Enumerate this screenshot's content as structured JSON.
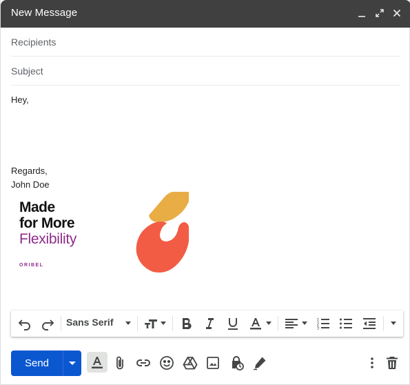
{
  "window": {
    "title": "New Message"
  },
  "compose": {
    "recipients_placeholder": "Recipients",
    "subject_placeholder": "Subject",
    "body": {
      "greeting": "Hey,",
      "regards": "Regards,",
      "name": "John Doe"
    },
    "signature_banner": {
      "line1": "Made",
      "line2": "for More",
      "line3": "Flexibility",
      "brand": "ORIBEL",
      "colors": {
        "primary": "#8e2d8a",
        "shape_top": "#e8ad45",
        "shape_bottom": "#f25c45"
      }
    }
  },
  "format_toolbar": {
    "font_family": "Sans Serif",
    "icons": [
      "undo-icon",
      "redo-icon",
      "font-size-icon",
      "bold-icon",
      "italic-icon",
      "underline-icon",
      "text-color-icon",
      "align-icon",
      "numbered-list-icon",
      "bulleted-list-icon",
      "indent-less-icon",
      "more-formatting-icon"
    ]
  },
  "bottom_bar": {
    "send_label": "Send",
    "send_color": "#0b57d0",
    "icons": [
      "formatting-options-icon",
      "attach-icon",
      "link-icon",
      "emoji-icon",
      "drive-icon",
      "photo-icon",
      "confidential-mode-icon",
      "signature-icon",
      "more-options-icon",
      "discard-icon"
    ]
  },
  "colors": {
    "titlebar": "#404040",
    "text_muted": "#5f6368",
    "text": "#202124"
  }
}
